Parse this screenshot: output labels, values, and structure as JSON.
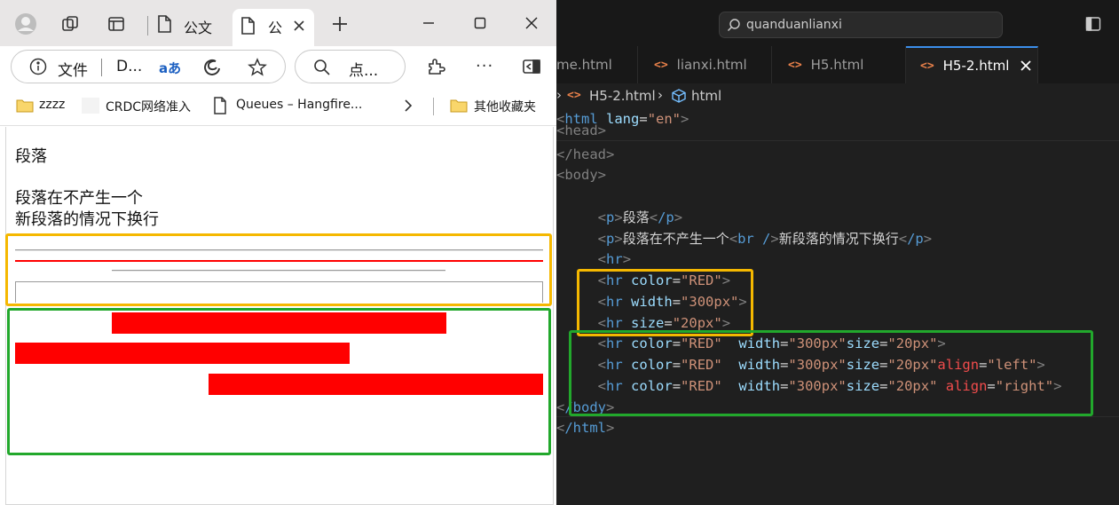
{
  "browser": {
    "tabs": [
      {
        "label": "公文"
      },
      {
        "label": "公"
      }
    ],
    "address": {
      "prefix": "文件",
      "url": "D..."
    },
    "search_placeholder": "点...",
    "read_aloud_label": "aあ",
    "favorites": [
      {
        "label": "zzzz"
      },
      {
        "label": "CRDC网络准入"
      },
      {
        "label": "Queues – Hangfire..."
      },
      {
        "label": "其他收藏夹"
      }
    ],
    "page": {
      "para1": "段落",
      "para2_line1": "段落在不产生一个",
      "para2_line2": "新段落的情况下换行"
    }
  },
  "editor": {
    "command_center": "quanduanlianxi",
    "tabs": [
      {
        "label": "me.html"
      },
      {
        "label": "lianxi.html"
      },
      {
        "label": "H5.html"
      },
      {
        "label": "H5-2.html"
      }
    ],
    "breadcrumb": {
      "file": "H5-2.html",
      "symbol": "html"
    },
    "code": {
      "l1_tag": "html",
      "l1_attr": "lang",
      "l1_val": "\"en\"",
      "l2": "<head>",
      "l3": "</head>",
      "l4": "<body>",
      "p_open": "p",
      "p_close": "/p",
      "p1_text": "段落",
      "p2_text_a": "段落在不产生一个",
      "br_tag": "br /",
      "p2_text_b": "新段落的情况下换行",
      "hr": "hr",
      "attr_color": "color",
      "attr_width": "width",
      "attr_size": "size",
      "attr_align": "align",
      "val_red": "\"RED\"",
      "val_300": "\"300px\"",
      "val_20": "\"20px\"",
      "val_left": "\"left\"",
      "val_right": "\"right\"",
      "body_close": "/body",
      "html_close": "/html"
    }
  },
  "colors": {
    "annotation_orange": "#f5b800",
    "annotation_green": "#22a82c",
    "hr_red": "#ff0000"
  }
}
